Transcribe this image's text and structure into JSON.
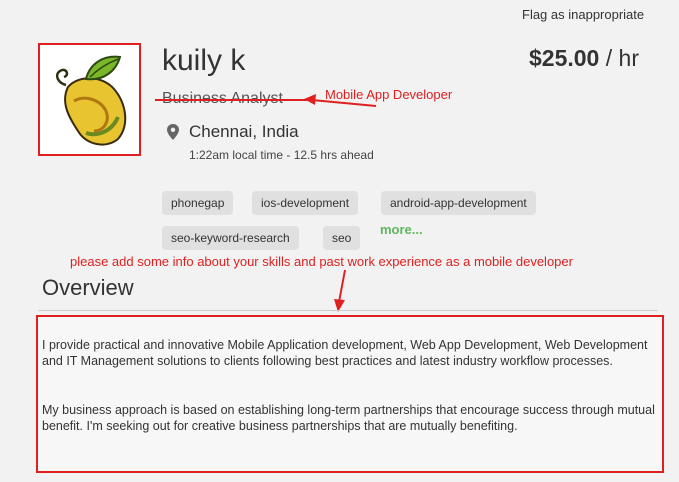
{
  "header": {
    "flag_label": "Flag as inappropriate"
  },
  "profile": {
    "name": "kuily k",
    "title": "Business Analyst",
    "rate_amount": "$25.00",
    "rate_unit": "/ hr",
    "location": "Chennai, India",
    "local_time": "1:22am local time - 12.5 hrs ahead"
  },
  "annotations": {
    "title_replacement": "Mobile App Developer",
    "overview_note": "please add some info about your skills and past work experience as a mobile developer",
    "color": "#e02020"
  },
  "skills": {
    "tags": [
      "phonegap",
      "ios-development",
      "android-app-development",
      "seo-keyword-research",
      "seo"
    ],
    "more_label": "more..."
  },
  "overview": {
    "heading": "Overview",
    "paragraphs": [
      "I provide practical and innovative Mobile Application development, Web App Development, Web Development and IT Management solutions to clients following best practices and latest industry workflow processes.",
      "My business approach is based on establishing long-term partnerships that encourage success through mutual benefit.  I'm seeking out for creative business partnerships that are mutually benefiting."
    ]
  },
  "icons": {
    "location": "map-pin-icon",
    "avatar": "mango-logo"
  }
}
